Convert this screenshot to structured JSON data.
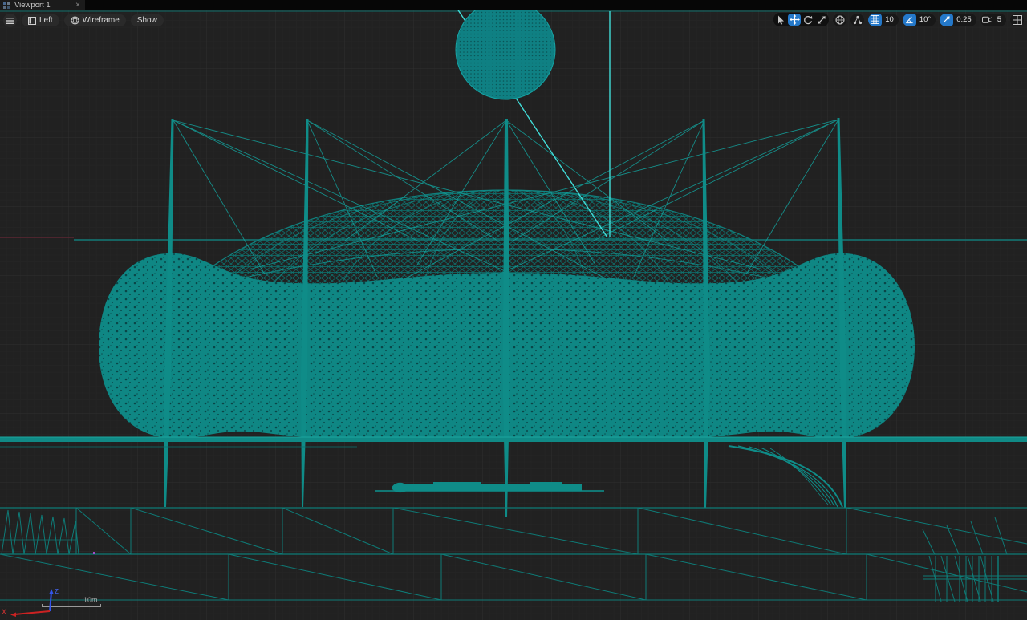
{
  "window": {
    "tab": {
      "label": "Viewport 1",
      "close_label": "×"
    }
  },
  "toolbar_left": {
    "view_button": {
      "label": "Left"
    },
    "mode_button": {
      "label": "Wireframe"
    },
    "show_button": {
      "label": "Show"
    }
  },
  "toolbar_right": {
    "active_tool": "move",
    "grid_snap": {
      "value": "10"
    },
    "rotation_snap": {
      "value": "10°"
    },
    "scale_snap": {
      "value": "0.25"
    },
    "camera_speed": {
      "value": "5"
    }
  },
  "viewport": {
    "scale_bar": {
      "label": "10m"
    },
    "axis_gizmo": {
      "x_label": "X",
      "z_label": "Z"
    },
    "colors": {
      "background": "#202020",
      "wireframe": "#0F8C88",
      "wireframe_bright": "#41DCD8",
      "accent_blue": "#2478C9",
      "axis_red": "#CC2222",
      "axis_blue": "#3355EE",
      "grid_line_red": "#5C2733"
    }
  }
}
